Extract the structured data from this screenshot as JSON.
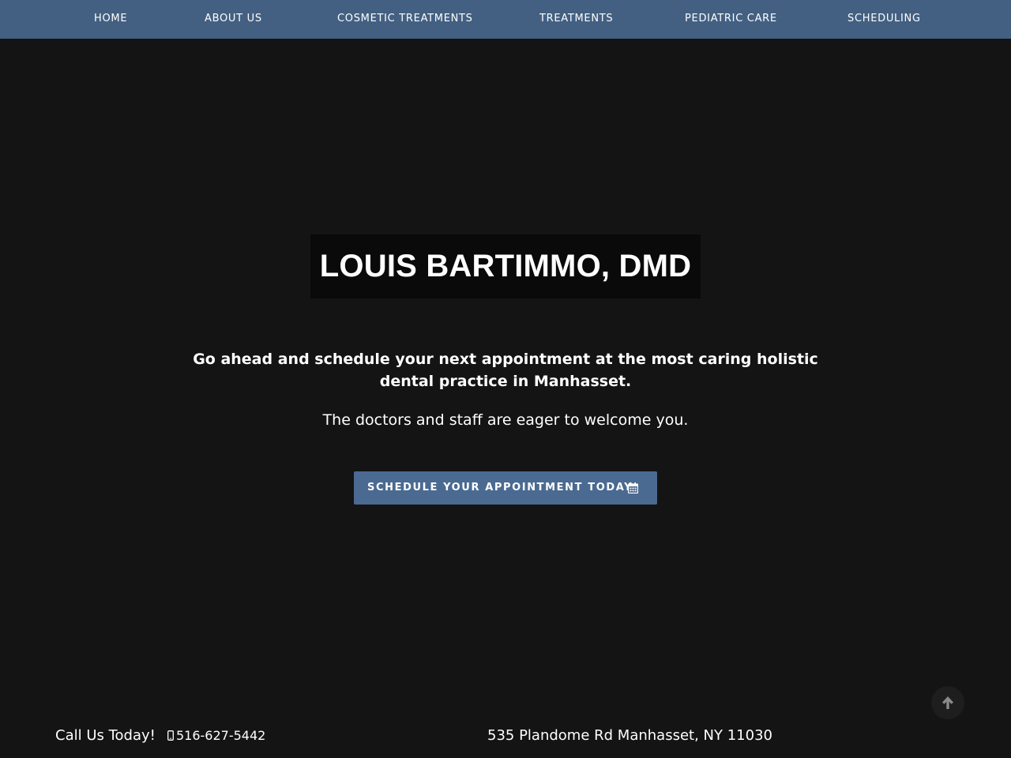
{
  "nav": {
    "items": [
      {
        "label": "HOME"
      },
      {
        "label": "ABOUT US"
      },
      {
        "label": "COSMETIC TREATMENTS"
      },
      {
        "label": "TREATMENTS"
      },
      {
        "label": "PEDIATRIC CARE"
      },
      {
        "label": "SCHEDULING"
      }
    ]
  },
  "hero": {
    "title": "LOUIS BARTIMMO, DMD",
    "lead": "Go ahead and schedule your next appointment at the most caring holistic dental practice in Manhasset.",
    "sub": "The doctors and staff are eager to welcome you.",
    "cta_label": "SCHEDULE YOUR APPOINTMENT TODAY",
    "cta_icon": "calendar-icon"
  },
  "footer": {
    "call_label": "Call Us Today!",
    "phone_icon": "mobile-phone-icon",
    "phone": "516-627-5442",
    "address": "535 Plandome Rd Manhasset, NY 11030",
    "scroll_icon": "arrow-up-icon"
  },
  "colors": {
    "nav_bg": "#436082",
    "page_bg": "#141414",
    "title_box_bg": "#0a0a0a",
    "cta_bg": "#4b6a91",
    "text": "#ffffff"
  }
}
